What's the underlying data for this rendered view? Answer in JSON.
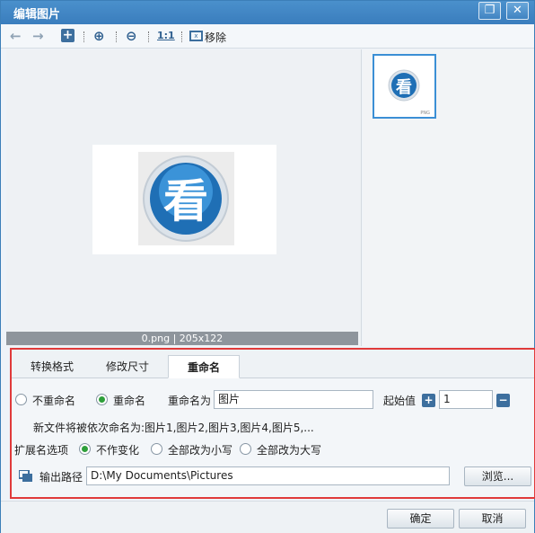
{
  "window": {
    "title": "编辑图片",
    "restore_icon": "restore-icon",
    "close_icon": "close-icon"
  },
  "toolbar": {
    "back_icon": "arrow-left-icon",
    "forward_icon": "arrow-right-icon",
    "add_icon": "plus-square-icon",
    "zoom_in_icon": "zoom-in-icon",
    "zoom_out_icon": "zoom-out-icon",
    "actual_size_label": "1:1",
    "remove_label": "移除"
  },
  "preview": {
    "image_glyph": "看",
    "caption": "0.png | 205x122"
  },
  "thumbnail": {
    "image_glyph": "看",
    "type_label": "PNG"
  },
  "tabs": [
    {
      "label": "转换格式"
    },
    {
      "label": "修改尺寸"
    },
    {
      "label": "重命名"
    }
  ],
  "rename": {
    "no_rename_label": "不重命名",
    "rename_label": "重命名",
    "rename_as_label": "重命名为",
    "rename_as_value": "图片",
    "start_value_label": "起始值",
    "start_value": "1",
    "hint": "新文件将被依次命名为:图片1,图片2,图片3,图片4,图片5,..."
  },
  "extension": {
    "label": "扩展名选项",
    "unchanged_label": "不作变化",
    "lower_label": "全部改为小写",
    "upper_label": "全部改为大写"
  },
  "output": {
    "label": "输出路径",
    "path": "D:\\My Documents\\Pictures",
    "browse_label": "浏览..."
  },
  "footer": {
    "ok_label": "确定",
    "cancel_label": "取消"
  },
  "colors": {
    "accent": "#3a7dbd",
    "highlight_border": "#e03a3a",
    "radio_selected": "#2e9f3a"
  }
}
